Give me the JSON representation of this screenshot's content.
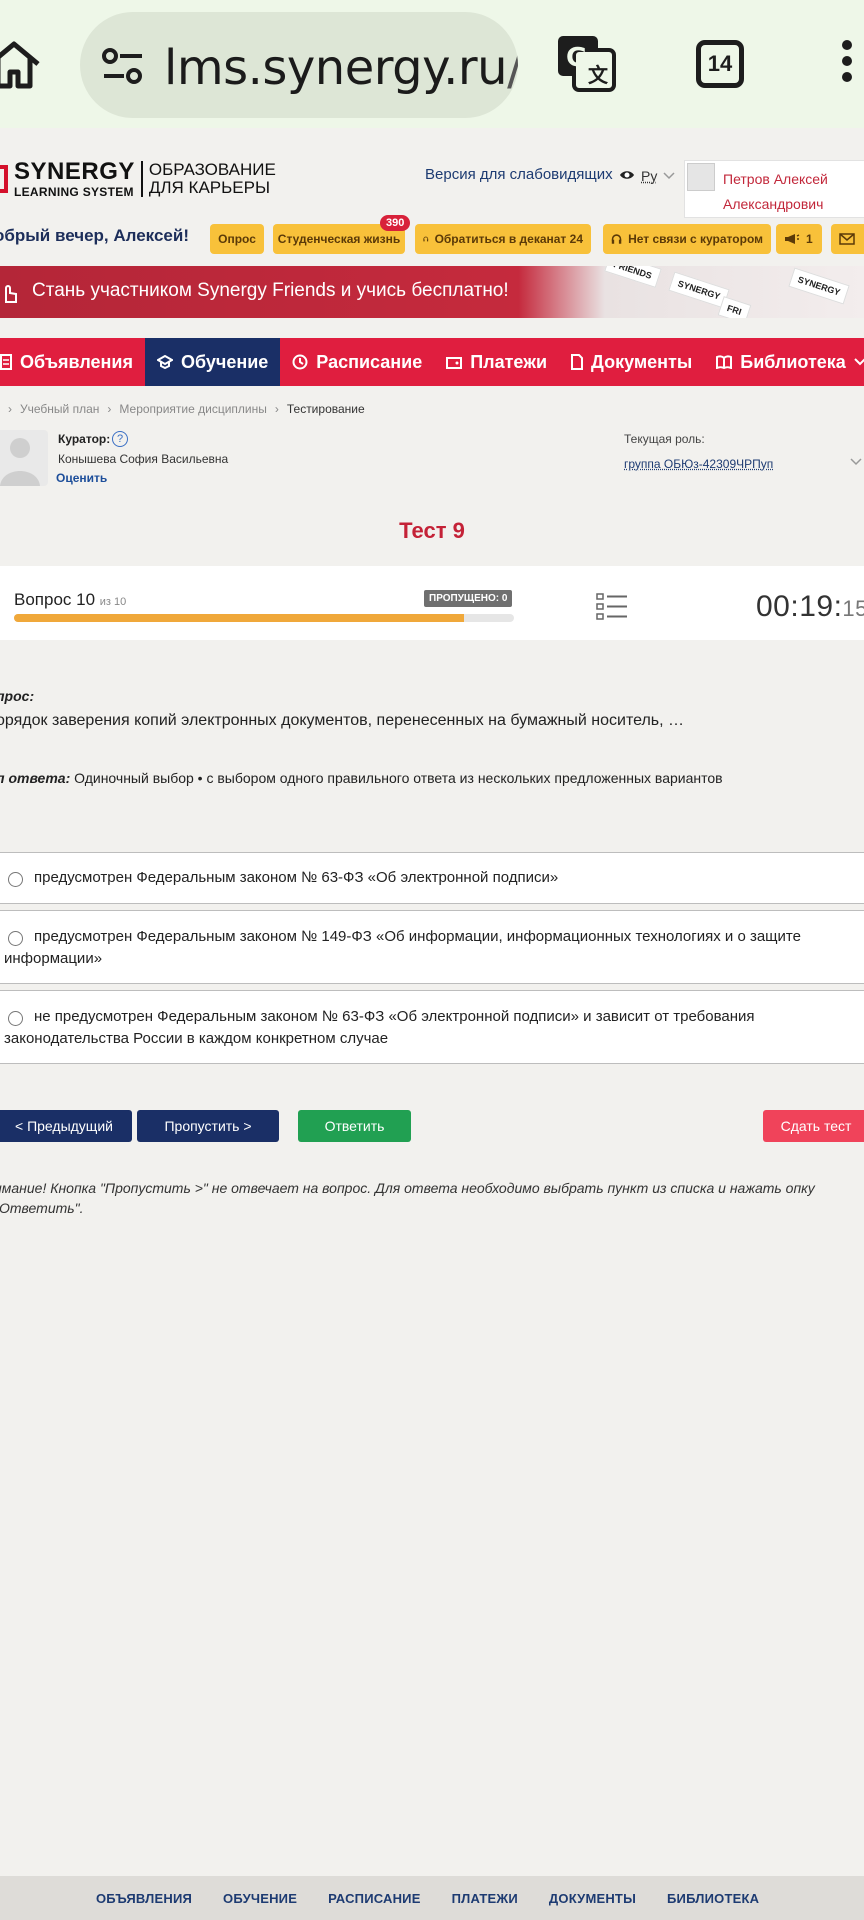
{
  "browser": {
    "url_main": "lms.synergy.ru",
    "url_rest": "/as",
    "tab_count": "14"
  },
  "header": {
    "logo_line1": "SYNERGY",
    "logo_line2": "LEARNING SYSTEM",
    "slogan_line1": "ОБРАЗОВАНИЕ",
    "slogan_line2": "ДЛЯ КАРЬЕРЫ",
    "vision_link": "Версия для слабовидящих",
    "lang": "Ру",
    "user_name_line1": "Петров Алексей",
    "user_name_line2": "Александрович"
  },
  "greeting": "обрый вечер, Алексей!",
  "quick_buttons": {
    "survey": "Опрос",
    "student_life": "Студенческая жизнь",
    "student_life_badge": "390",
    "dean": "Обратиться в деканат 24",
    "curator": "Нет связи с куратором",
    "announce_count": "1"
  },
  "banner": {
    "text": "Стань участником Synergy Friends и учись бесплатно!",
    "card1": "FRIENDS",
    "card2": "SYNERGY",
    "card3": "FRI"
  },
  "nav": {
    "announcements": "Объявления",
    "learning": "Обучение",
    "schedule": "Расписание",
    "payments": "Платежи",
    "documents": "Документы",
    "library": "Библиотека"
  },
  "breadcrumb": {
    "item1": "Учебный план",
    "item2": "Мероприятие дисциплины",
    "item3": "Тестирование"
  },
  "curator": {
    "label": "Куратор:",
    "help": "?",
    "name": "Конышева София Васильевна",
    "rate": "Оценить"
  },
  "role": {
    "label": "Текущая роль:",
    "value": "группа ОБЮз-42309ЧРПуп"
  },
  "test": {
    "title": "Тест 9",
    "question_label": "Вопрос 10",
    "question_of": "из 10",
    "skipped": "ПРОПУЩЕНО: 0",
    "progress": 0.9,
    "timer_main": "00:19:",
    "timer_sec": "15"
  },
  "question": {
    "label": "прос:",
    "text": "орядок заверения копий электронных документов, перенесенных на бумажный носитель, …",
    "type_label": "п ответа:",
    "type_text": " Одиночный выбор • с выбором одного правильного ответа из нескольких предложенных вариантов"
  },
  "options": [
    "предусмотрен Федеральным законом № 63-ФЗ «Об электронной подписи»",
    "предусмотрен Федеральным законом № 149-ФЗ «Об информации, информационных технологиях и о защите информации»",
    "не предусмотрен Федеральным законом № 63-ФЗ «Об электронной подписи» и зависит от требования законодательства России в каждом конкретном случае"
  ],
  "buttons": {
    "prev": "< Предыдущий",
    "skip": "Пропустить >",
    "answer": "Ответить",
    "submit": "Сдать тест"
  },
  "warning": "имание! Кнопка \"Пропустить >\" не отвечает на вопрос. Для ответа необходимо выбрать пункт из списка и нажать опку \"Ответить\".",
  "footer": {
    "announcements": "ОБЪЯВЛЕНИЯ",
    "learning": "ОБУЧЕНИЕ",
    "schedule": "РАСПИСАНИЕ",
    "payments": "ПЛАТЕЖИ",
    "documents": "ДОКУМЕНТЫ",
    "library": "БИБЛИОТЕКА"
  },
  "colors": {
    "brand_red": "#e01e3f",
    "nav_active": "#1a2f66",
    "accent_yellow": "#f8c13a",
    "answer_green": "#21a052",
    "submit_red": "#f0435a",
    "progress_orange": "#f0a83a"
  }
}
